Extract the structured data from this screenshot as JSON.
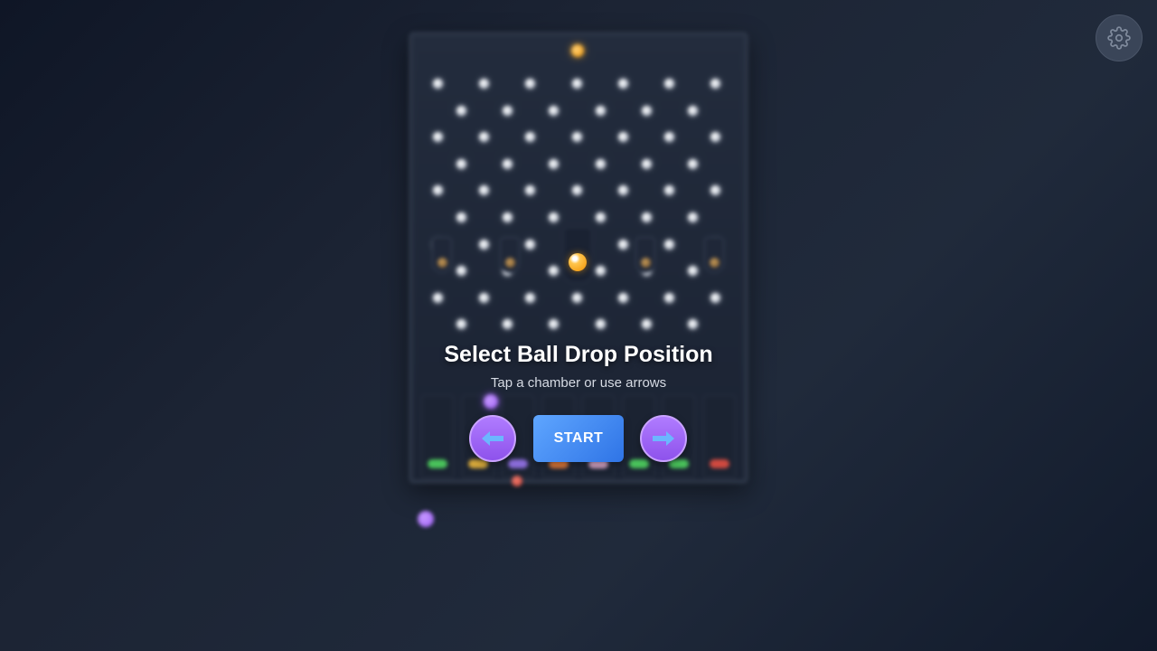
{
  "settings": {
    "icon": "gear-icon"
  },
  "board": {
    "peg_rows": [
      7,
      6,
      7,
      6,
      7,
      6,
      7,
      6,
      7,
      6
    ],
    "chamber_count": 5,
    "selected_chamber": 3,
    "slot_count": 8,
    "slot_chip_colors": [
      "#49c25a",
      "#d6a83a",
      "#8a6bd8",
      "#e07a3a",
      "#d9a7c9",
      "#49c25a",
      "#49c25a",
      "#d0493f"
    ]
  },
  "overlay": {
    "title": "Select Ball Drop Position",
    "subtitle": "Tap a chamber or use arrows"
  },
  "controls": {
    "left_icon": "left-arrow-icon",
    "start_label": "START",
    "right_icon": "right-arrow-icon"
  },
  "colors": {
    "arrow_purple": "#9b59f5",
    "start_blue": "#3b82f6",
    "ball_orange": "#f5a623"
  }
}
